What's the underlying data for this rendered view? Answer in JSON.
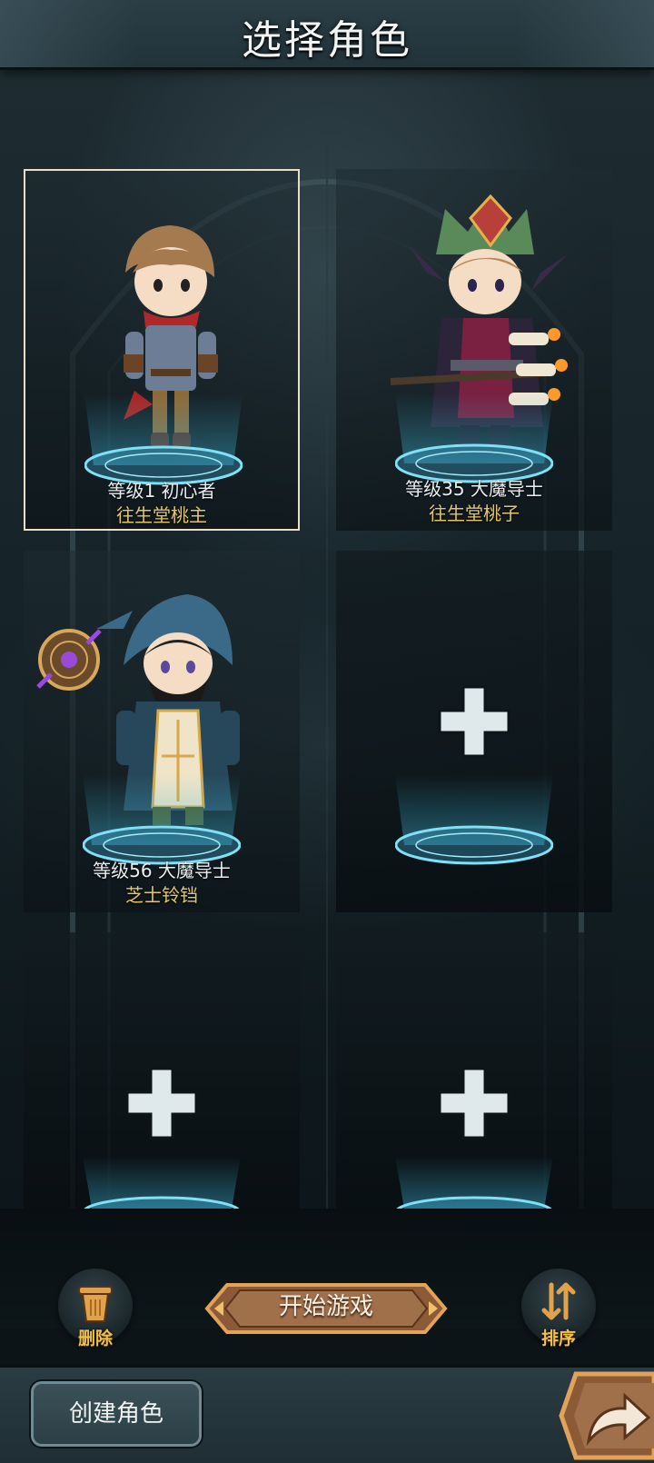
{
  "header": {
    "title": "选择角色"
  },
  "slots": [
    {
      "level": "等级1  初心者",
      "name": "往生堂桃主",
      "selected": true
    },
    {
      "level": "等级35  大魔导士",
      "name": "往生堂桃子",
      "selected": false
    },
    {
      "level": "等级56  大魔导士",
      "name": "芝士铃铛",
      "selected": false
    },
    {
      "empty": true
    },
    {
      "empty": true
    },
    {
      "empty": true
    }
  ],
  "controls": {
    "delete_label": "删除",
    "start_label": "开始游戏",
    "sort_label": "排序"
  },
  "footer": {
    "create_label": "创建角色"
  },
  "colors": {
    "level_text": "#e9eef0",
    "name_text": "#e3c56a",
    "platform_glow": "#3fb6d8",
    "button_bronze": "#c98a4a"
  },
  "icons": [
    "trash-icon",
    "sort-icon",
    "plus-icon",
    "arrow-forward-icon",
    "mage-badge-icon"
  ]
}
